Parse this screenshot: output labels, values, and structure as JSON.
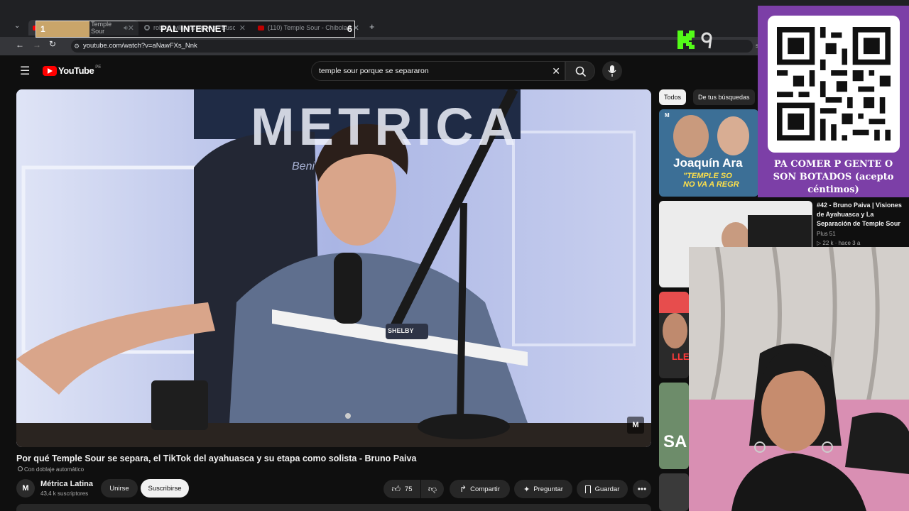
{
  "browser": {
    "tabs": [
      {
        "label": "Temple Sour",
        "active": true
      },
      {
        "label": "robbie williams angels - Buscar"
      },
      {
        "label": "(110) Temple Sour - Chibola M"
      }
    ],
    "url": "youtube.com/watch?v=aNawFXs_Nnk"
  },
  "overlay": {
    "number": "1",
    "title": "PAL INTERNET",
    "count": "6"
  },
  "youtube": {
    "logo": "YouTube",
    "region": "PE",
    "search_query": "temple sour porque se separaron",
    "video": {
      "title": "Por qué Temple Sour se separa, el TikTok del ayahuasca y su etapa como solista - Bruno Paiva",
      "dub_label": "Con doblaje automático",
      "channel": "Métrica Latina",
      "subscribers": "43,4 k suscriptores",
      "join_label": "Unirse",
      "subscribe_label": "Suscribirse",
      "likes": "75",
      "share_label": "Compartir",
      "ask_label": "Preguntar",
      "save_label": "Guardar",
      "wall_text": "METRICA",
      "chair_text": "Beni",
      "shirt_badge": "SHELBY"
    },
    "chips": [
      "Todos",
      "De tus búsquedas"
    ],
    "recommendations": [
      {
        "thumb_text": "Joaquín Ara",
        "thumb_sub": "\"TEMPLE SO\nNO VA A REGR"
      },
      {
        "title": "#42 - Bruno Paiva | Visiones de Ayahuasca y La Separación de Temple Sour",
        "channel": "Plus 51",
        "meta": "▷ 22 k · hace 3 a"
      },
      {
        "thumb_text": "LLE"
      },
      {
        "thumb_text": "SA"
      }
    ]
  },
  "stream": {
    "qr_text": "PA COMER P GENTE O SON BOTADOS (acepto céntimos)",
    "kick_label": "K"
  },
  "colors": {
    "accent_purple": "#7c3fa7",
    "youtube_red": "#ff0000",
    "kick_green": "#53fc18"
  }
}
